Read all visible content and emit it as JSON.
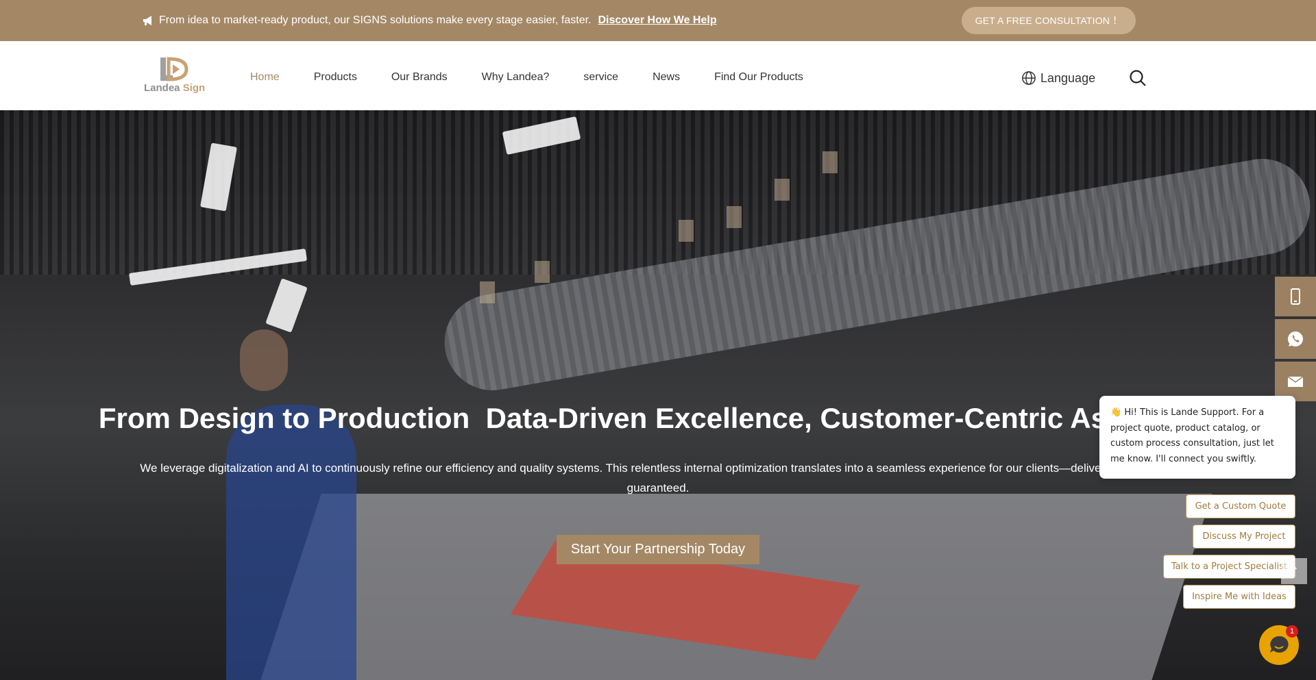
{
  "topbar": {
    "announcement": "From idea to market-ready product, our SIGNS solutions make every stage easier, faster.",
    "link_label": "Discover How We Help",
    "consult_label": "GET A FREE CONSULTATION  ！"
  },
  "logo": {
    "word": "Landea",
    "sign": "Sign"
  },
  "nav": {
    "items": [
      {
        "label": "Home"
      },
      {
        "label": "Products"
      },
      {
        "label": "Our Brands"
      },
      {
        "label": "Why Landea?"
      },
      {
        "label": "service"
      },
      {
        "label": "News"
      },
      {
        "label": "Find Our Products"
      }
    ],
    "language_label": "Language"
  },
  "hero": {
    "title": "From Design to Production  Data-Driven Excellence, Customer-Centric Assurance",
    "subtitle": "We leverage digitalization and AI to continuously refine our efficiency and quality systems. This relentless internal optimization translates into a seamless experience for our clients—delivering on quality, guaranteed.",
    "cta_label": "Start Your Partnership Today"
  },
  "side_strip": {
    "icons": [
      "phone-icon",
      "whatsapp-icon",
      "email-icon"
    ]
  },
  "chat": {
    "message": "👋 Hi! This is Lande Support. For a project quote, product catalog, or custom process consultation, just let me know. I'll connect you swiftly.",
    "options": [
      {
        "label": "Get a Custom Quote"
      },
      {
        "label": "Discuss My Project"
      },
      {
        "label": "Talk to a Project Specialist"
      },
      {
        "label": "Inspire Me with Ideas"
      }
    ],
    "badge_count": "1"
  },
  "colors": {
    "brand": "#a48866",
    "chat_accent": "#c09a5b",
    "launcher": "#e8a300"
  }
}
